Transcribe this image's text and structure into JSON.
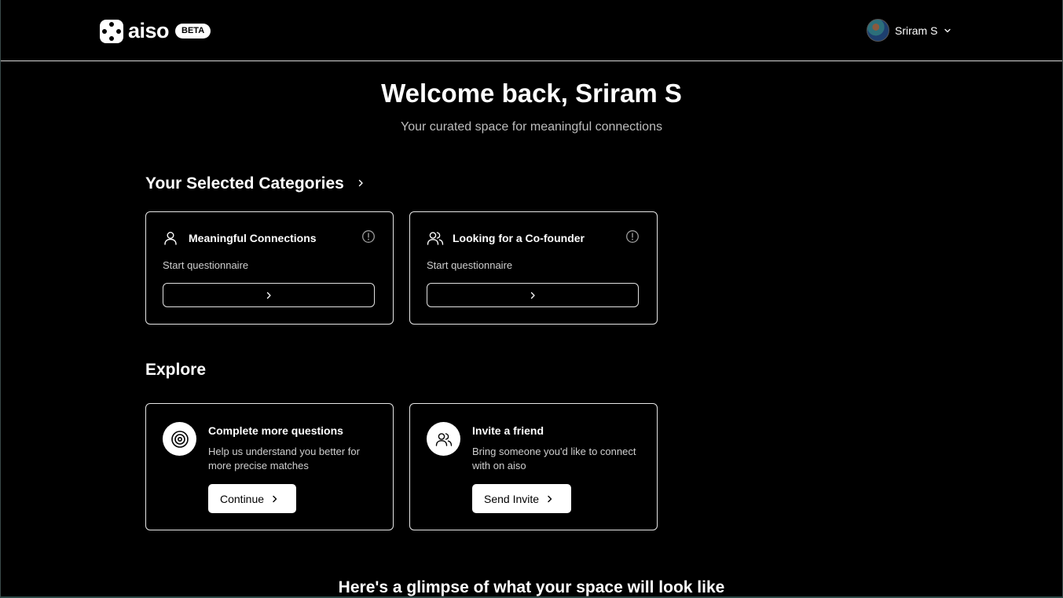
{
  "header": {
    "logo_text": "aiso",
    "badge": "BETA",
    "user_name": "Sriram S"
  },
  "hero": {
    "title": "Welcome back, Sriram S",
    "subtitle": "Your curated space for meaningful connections"
  },
  "categories": {
    "title": "Your Selected Categories",
    "items": [
      {
        "title": "Meaningful Connections",
        "status": "Start questionnaire",
        "icon": "user-icon"
      },
      {
        "title": "Looking for a Co-founder",
        "status": "Start questionnaire",
        "icon": "users-icon"
      }
    ]
  },
  "explore": {
    "title": "Explore",
    "items": [
      {
        "title": "Complete more questions",
        "description": "Help us understand you better for more precise matches",
        "button": "Continue",
        "icon": "target-icon"
      },
      {
        "title": "Invite a friend",
        "description": "Bring someone you'd like to connect with on aiso",
        "button": "Send Invite",
        "icon": "users-icon"
      }
    ]
  },
  "glimpse_title": "Here's a glimpse of what your space will look like"
}
